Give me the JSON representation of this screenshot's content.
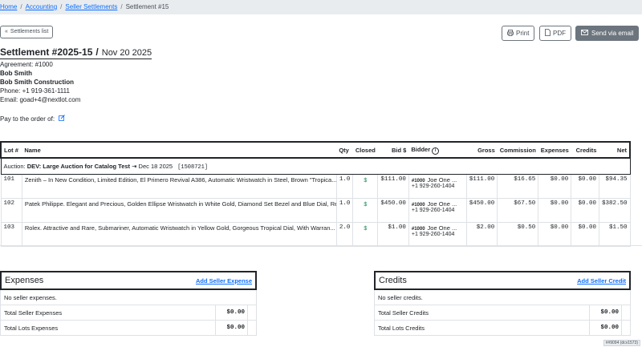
{
  "breadcrumb": {
    "home": "Home",
    "accounting": "Accounting",
    "seller_settlements": "Seller Settlements",
    "current": "Settlement #15"
  },
  "toolbar": {
    "back_label": "Settlements list",
    "print_label": "Print",
    "pdf_label": "PDF",
    "email_label": "Send via email"
  },
  "settlement": {
    "number": "Settlement #2025-15",
    "date": "Nov 20 2025"
  },
  "seller": {
    "agreement": "Agreement: #1000",
    "name": "Bob Smith",
    "company": "Bob Smith Construction",
    "phone": "Phone: +1 919-361-1111",
    "email": "Email: goad+4@nextlot.com",
    "pay_to": "Pay to the order of:"
  },
  "lots_table": {
    "headers": {
      "lot": "Lot #",
      "name": "Name",
      "qty": "Qty",
      "closed": "Closed",
      "bid": "Bid $",
      "bidder": "Bidder",
      "gross": "Gross",
      "commission": "Commission",
      "expenses": "Expenses",
      "credits": "Credits",
      "net": "Net"
    },
    "auction": {
      "prefix": "Auction:",
      "name": "DEV: Large Auction for Catalog Test",
      "date": "Dec 18 2025",
      "code": "[1508721]"
    },
    "rows": [
      {
        "lot": "101",
        "name": "Zenith – In New Condition, Limited Edition, El Primero Revival A386, Automatic Wristwatch in Steel, Brown \"Tropica...",
        "qty": "1.0",
        "closed": "$",
        "bid": "$111.00",
        "bidder_id": "#1000",
        "bidder_name": "Joe One ...",
        "bidder_phone": "+1 929-260-1404",
        "gross": "$111.00",
        "commission": "$16.65",
        "expenses": "$0.00",
        "credits": "$0.00",
        "net": "$94.35"
      },
      {
        "lot": "102",
        "name": "Patek Philippe. Elegant and Precious, Golden Ellipse Wristwatch in White Gold, Diamond Set Bezel and Blue Dial, Re...",
        "qty": "1.0",
        "closed": "$",
        "bid": "$450.00",
        "bidder_id": "#1000",
        "bidder_name": "Joe One ...",
        "bidder_phone": "+1 929-260-1404",
        "gross": "$450.00",
        "commission": "$67.50",
        "expenses": "$0.00",
        "credits": "$0.00",
        "net": "$382.50"
      },
      {
        "lot": "103",
        "name": "Rolex. Attractive and Rare, Submariner, Automatic Wristwatch in Yellow Gold, Gorgeous Tropical Dial, With Warran...",
        "qty": "2.0",
        "closed": "$",
        "bid": "$1.00",
        "bidder_id": "#1000",
        "bidder_name": "Joe One ...",
        "bidder_phone": "+1 929-260-1404",
        "gross": "$2.00",
        "commission": "$0.50",
        "expenses": "$0.00",
        "credits": "$0.00",
        "net": "$1.50"
      }
    ]
  },
  "expenses": {
    "title": "Expenses",
    "add_link": "Add Seller Expense",
    "empty": "No seller expenses.",
    "total_seller_label": "Total Seller Expenses",
    "total_seller_value": "$0.00",
    "total_lots_label": "Total Lots Expenses",
    "total_lots_value": "$0.00"
  },
  "credits": {
    "title": "Credits",
    "add_link": "Add Seller Credit",
    "empty": "No seller credits.",
    "total_seller_label": "Total Seller Credits",
    "total_seller_value": "$0.00",
    "total_lots_label": "Total Lots Credits",
    "total_lots_value": "$0.00"
  },
  "build_badge": "##9094 (dcv1573)",
  "colors": {
    "link": "#0d6efd",
    "dark_button": "#6c757d",
    "check": "#198754",
    "crumb_bg": "#e9ecef"
  }
}
